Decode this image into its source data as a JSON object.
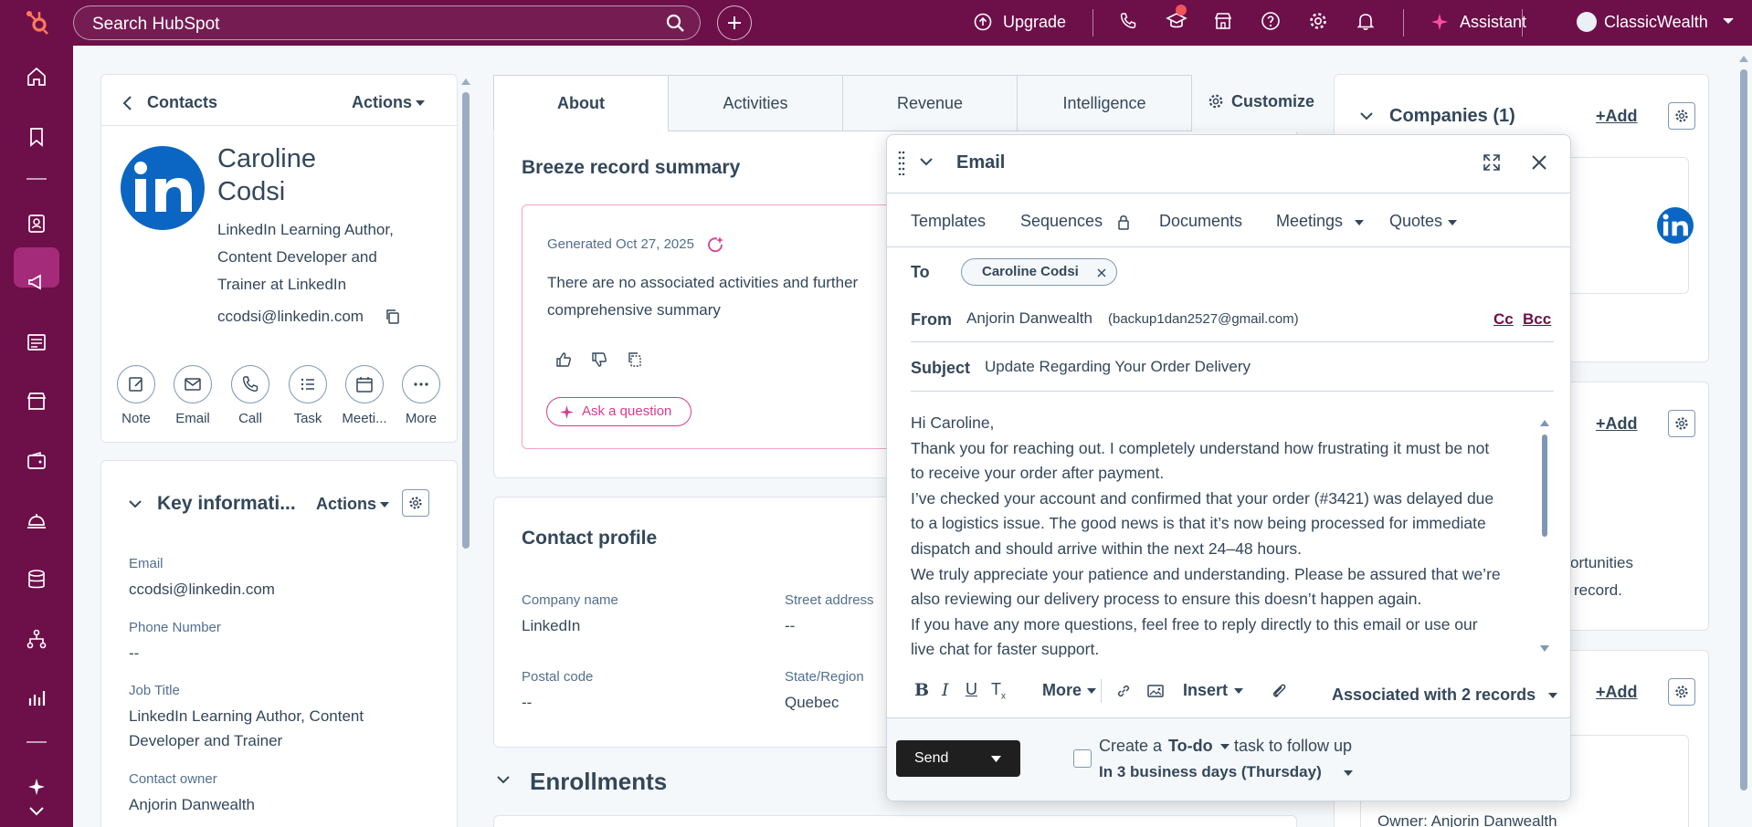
{
  "topbar": {
    "search_placeholder": "Search HubSpot",
    "upgrade_label": "Upgrade",
    "assistant_label": "Assistant",
    "account_name": "ClassicWealth"
  },
  "contact_card": {
    "back_label": "Contacts",
    "actions_label": "Actions",
    "first_name": "Caroline",
    "last_name": "Codsi",
    "headline": [
      "LinkedIn Learning Author,",
      "Content Developer and",
      "Trainer at LinkedIn"
    ],
    "email": "ccodsi@linkedin.com",
    "buttons": [
      "Note",
      "Email",
      "Call",
      "Task",
      "Meeti...",
      "More"
    ]
  },
  "key_info": {
    "title": "Key informati...",
    "actions_label": "Actions",
    "fields": [
      {
        "label": "Email",
        "value": "ccodsi@linkedin.com"
      },
      {
        "label": "Phone Number",
        "value": "--"
      },
      {
        "label": "Job Title",
        "value": "LinkedIn Learning Author, Content",
        "value2": "Developer and Trainer"
      },
      {
        "label": "Contact owner",
        "value": "Anjorin Danwealth"
      }
    ]
  },
  "tabs": [
    "About",
    "Activities",
    "Revenue",
    "Intelligence"
  ],
  "customize_label": "Customize",
  "breeze": {
    "title": "Breeze record summary",
    "generated": "Generated Oct 27, 2025",
    "text_line1": "There are no associated activities and further",
    "text_line2": "comprehensive summary",
    "ask_label": "Ask a question"
  },
  "contact_profile": {
    "title": "Contact profile",
    "company_label": "Company name",
    "company_value": "LinkedIn",
    "street_label": "Street address",
    "street_value": "--",
    "postal_label": "Postal code",
    "postal_value": "--",
    "state_label": "State/Region",
    "state_value": "Quebec"
  },
  "enrollments_title": "Enrollments",
  "right": {
    "companies_title": "Companies (1)",
    "add_label": "+Add",
    "opportunities_fragment": "ortunities",
    "record_fragment": "record.",
    "owner_text": "Owner: Anjorin Danwealth"
  },
  "email": {
    "title": "Email",
    "tools": [
      "Templates",
      "Sequences",
      "Documents",
      "Meetings",
      "Quotes"
    ],
    "to_label": "To",
    "to_recipient": "Caroline Codsi",
    "from_label": "From",
    "from_name": "Anjorin Danwealth",
    "from_address": "(backup1dan2527@gmail.com)",
    "cc_label": "Cc",
    "bcc_label": "Bcc",
    "subject_label": "Subject",
    "subject_value": "Update Regarding Your Order Delivery",
    "body_lines": [
      "Hi Caroline,",
      "Thank you for reaching out. I completely understand how frustrating it must be not",
      "to receive your order after payment.",
      "I’ve checked your account and confirmed that your order (#3421) was delayed due",
      "to a logistics issue. The good news is that it’s now being processed for immediate",
      "dispatch and should arrive within the next 24–48 hours.",
      "We truly appreciate your patience and understanding. Please be assured that we’re",
      "also reviewing our delivery process to ensure this doesn’t happen again.",
      "If you have any more questions, feel free to reply directly to this email or use our",
      "live chat for faster support."
    ],
    "more_label": "More",
    "insert_label": "Insert",
    "associated_label": "Associated with 2 records",
    "send_label": "Send",
    "todo_prefix": "Create a",
    "todo_type": "To-do",
    "todo_suffix": "task to follow up",
    "todo_when": "In 3 business days (Thursday)"
  },
  "colors": {
    "topbar": "#6d0f49",
    "accent_pink": "#d63c8f",
    "linkedin_blue": "#0a66c2"
  }
}
